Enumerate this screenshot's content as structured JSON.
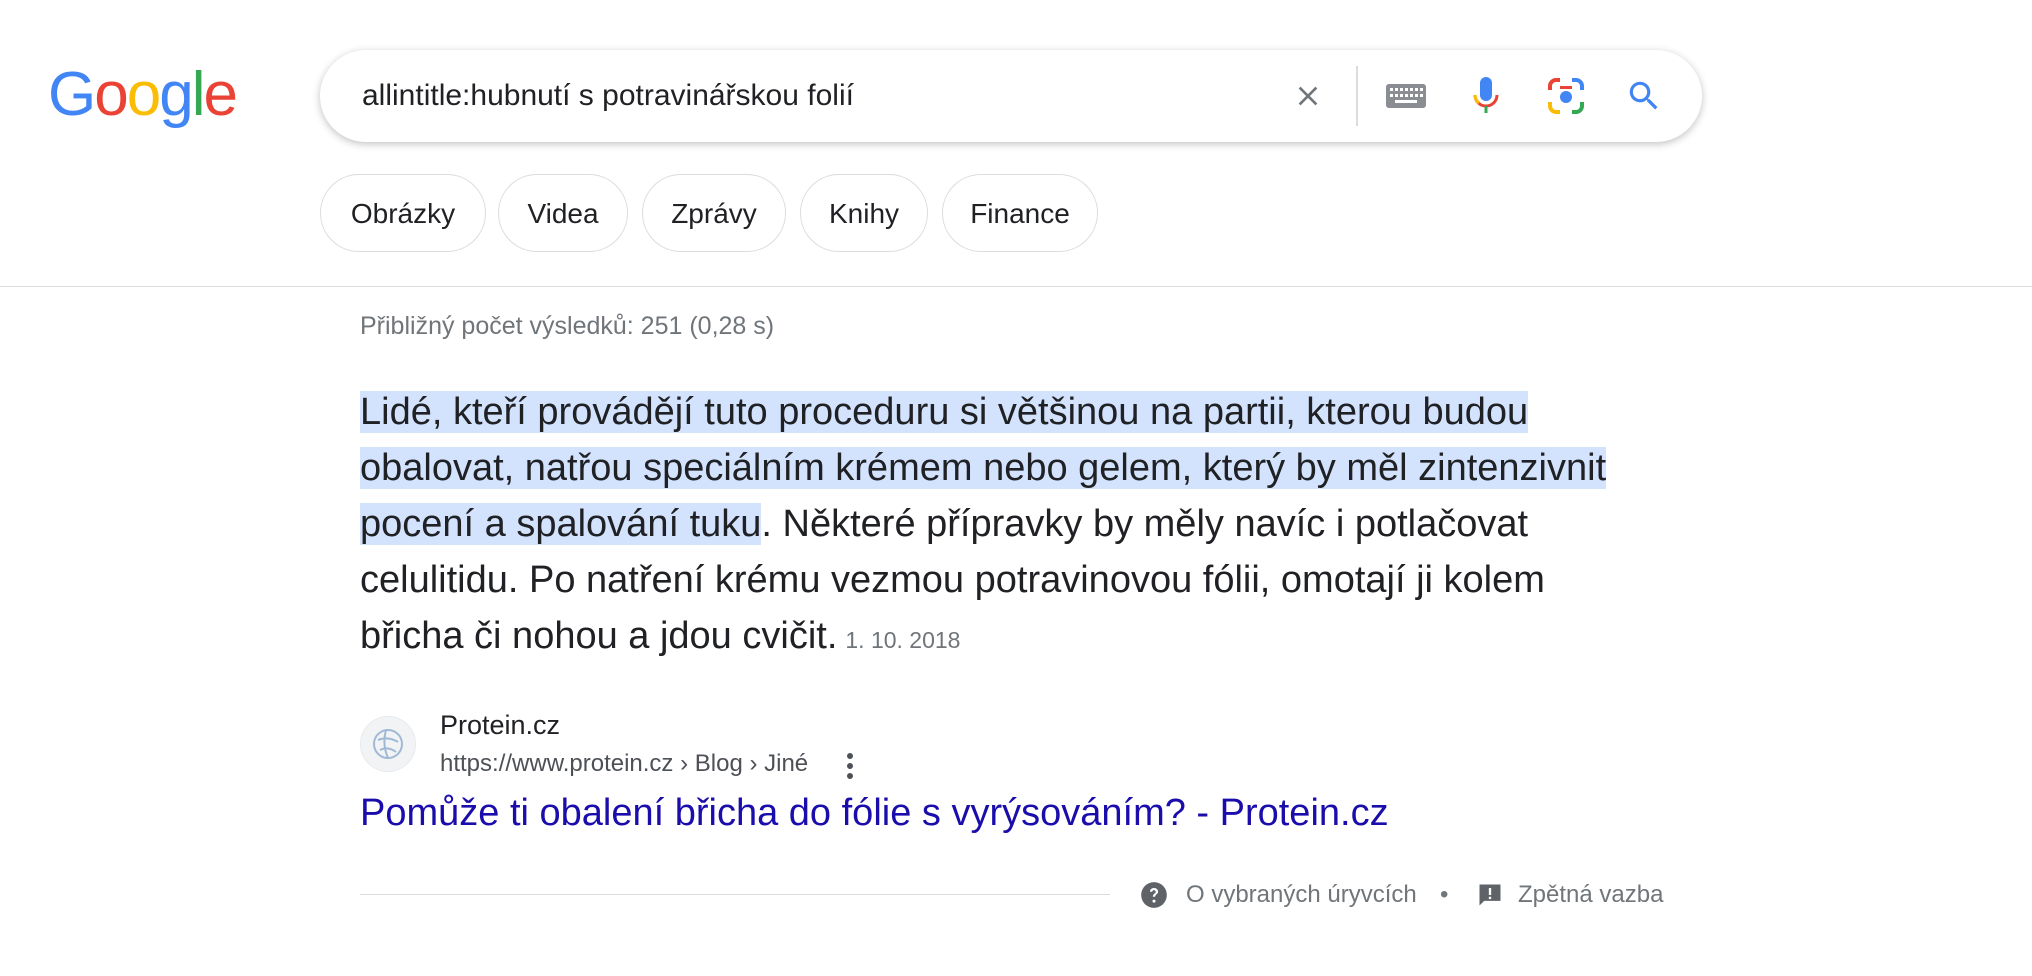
{
  "logo": {
    "letters": [
      "G",
      "o",
      "o",
      "g",
      "l",
      "e"
    ],
    "colors": [
      "#4285F4",
      "#EA4335",
      "#FBBC05",
      "#4285F4",
      "#34A853",
      "#EA4335"
    ]
  },
  "search": {
    "query": "allintitle:hubnutí s potravinářskou folií",
    "icons": [
      "close-icon",
      "keyboard-icon",
      "microphone-icon",
      "lens-icon",
      "search-icon"
    ]
  },
  "chips": [
    {
      "label": "Obrázky"
    },
    {
      "label": "Videa"
    },
    {
      "label": "Zprávy"
    },
    {
      "label": "Knihy"
    },
    {
      "label": "Finance"
    }
  ],
  "stats": "Přibližný počet výsledků: 251 (0,28 s)",
  "snippet": {
    "highlighted": "Lidé, kteří provádějí tuto proceduru si většinou na partii, kterou budou obalovat, natřou speciálním krémem nebo gelem, který by měl zintenzivnit pocení a spalování tuku",
    "rest": ". Některé přípravky by měly navíc i potlačovat celulitidu. Po natření krému vezmou potravinovou fólii, omotají ji kolem břicha či nohou a jdou cvičit.",
    "date": "1. 10. 2018"
  },
  "result": {
    "site_name": "Protein.cz",
    "url": "https://www.protein.cz › Blog › Jiné",
    "title": "Pomůže ti obalení břicha do fólie s vyrýsováním? - Protein.cz"
  },
  "footer": {
    "about": "O vybraných úryvcích",
    "bullet": "•",
    "feedback": "Zpětná vazba"
  },
  "colors": {
    "link": "#1a0dab",
    "highlight": "#d3e3fd",
    "accent": "#4285F4"
  }
}
